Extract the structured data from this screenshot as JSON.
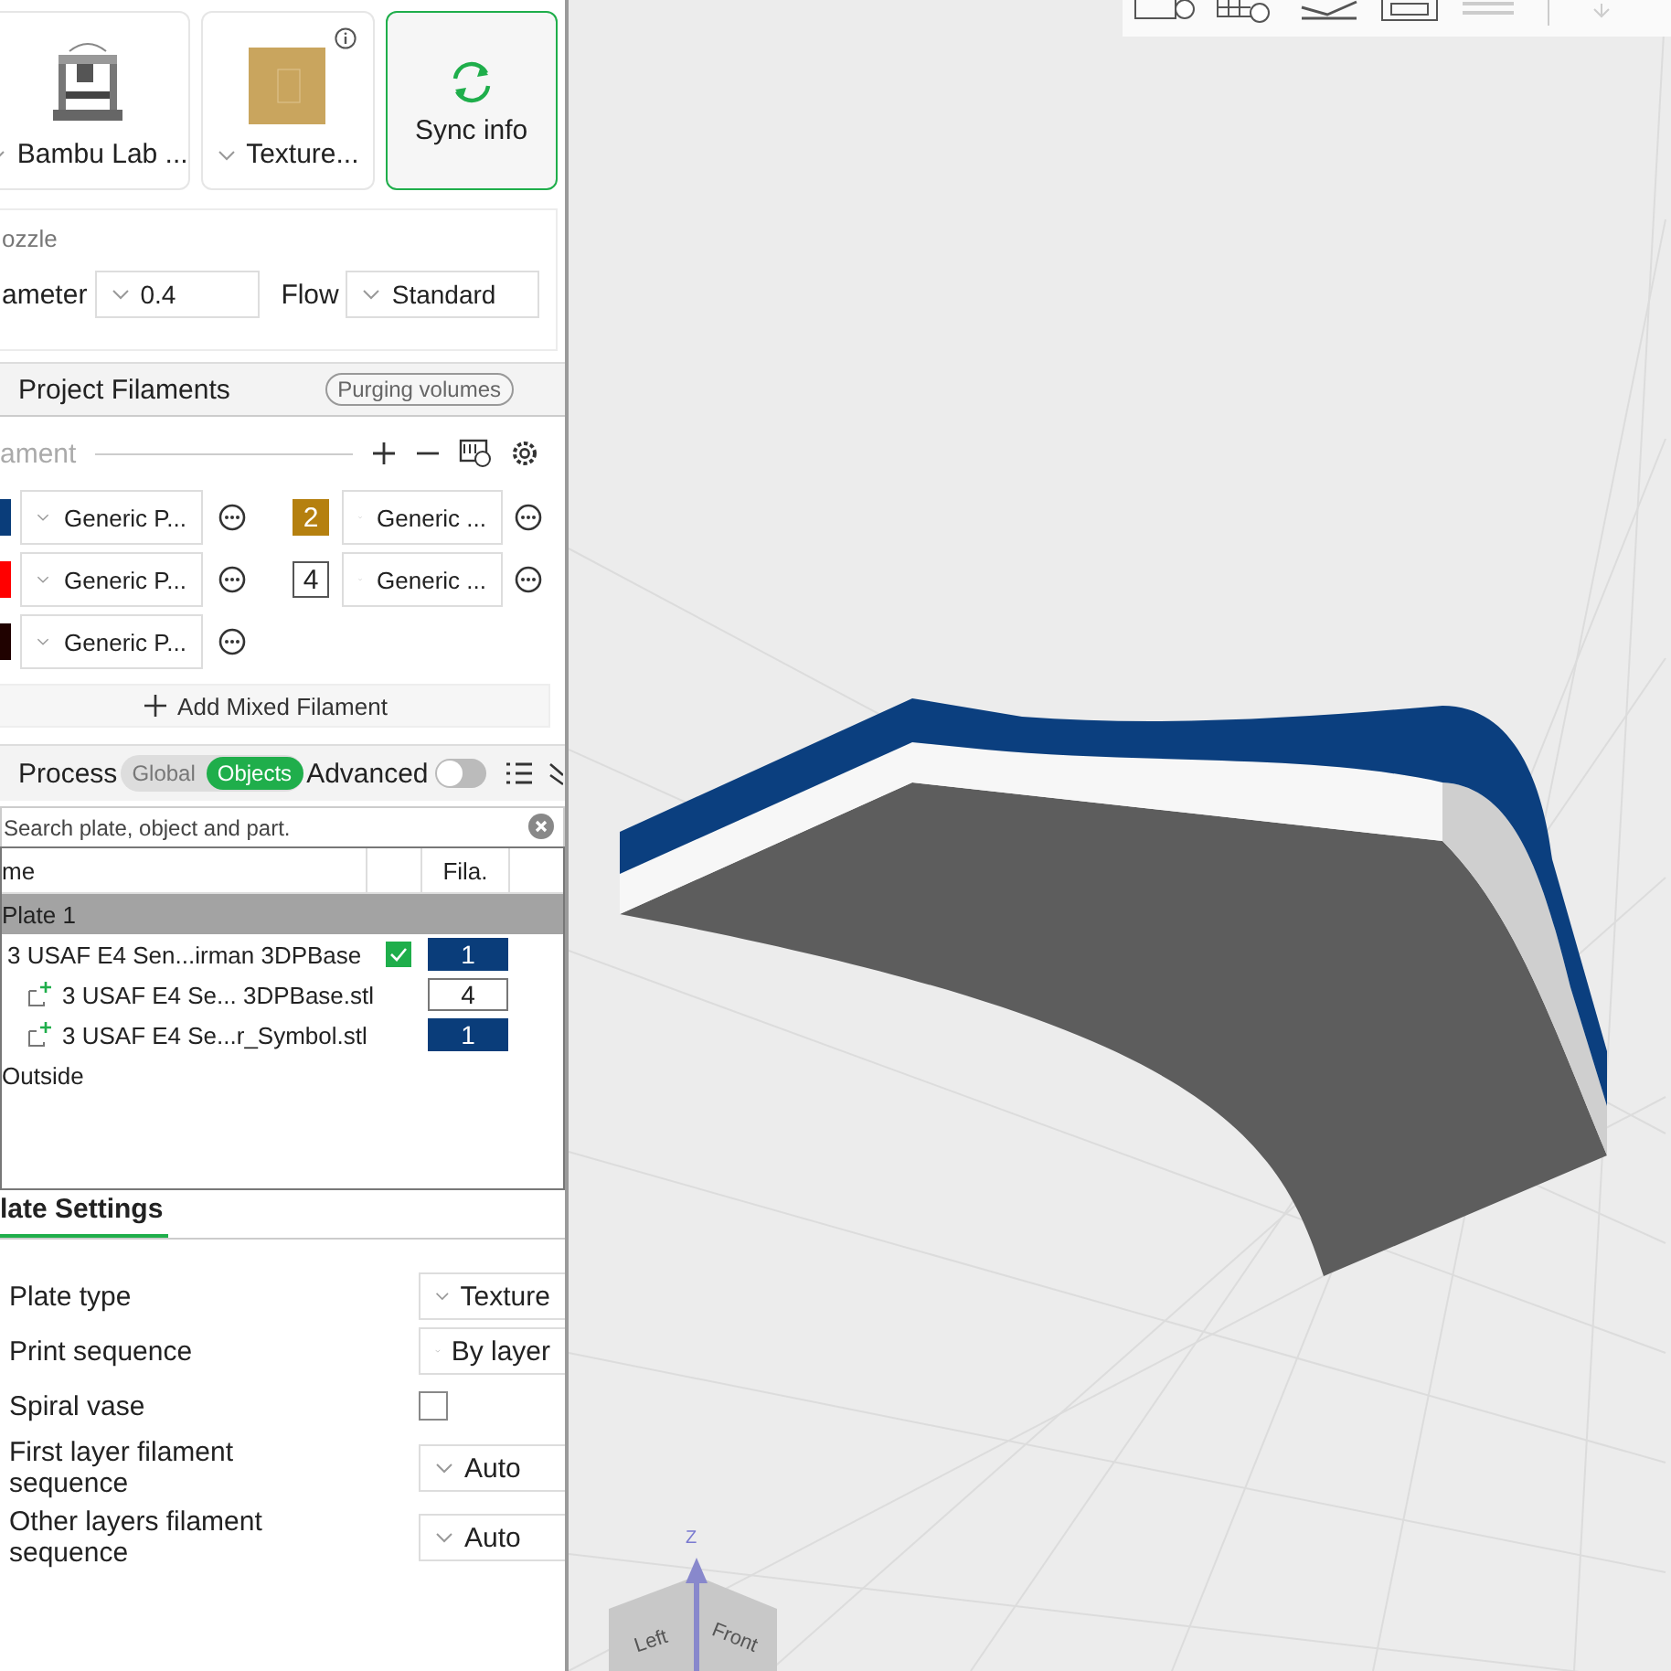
{
  "printer_cards": [
    {
      "kind": "printer",
      "label": "Bambu Lab ..."
    },
    {
      "kind": "plate",
      "label": "Texture..."
    },
    {
      "kind": "sync",
      "label": "Sync info"
    }
  ],
  "nozzle": {
    "title": "ozzle",
    "diameter_label": "ameter",
    "diameter": "0.4",
    "flow_label": "Flow",
    "flow": "Standard"
  },
  "filaments_header": {
    "title": "Project Filaments",
    "button": "Purging volumes"
  },
  "filament_toolbar": {
    "label": "ament"
  },
  "filaments": [
    {
      "color": "#0a3d7a",
      "name": "Generic P..."
    },
    {
      "color": "#b5800f",
      "number": "2",
      "name": "Generic ..."
    },
    {
      "color": "#ff0000",
      "name": "Generic P..."
    },
    {
      "color": "#ffffff",
      "number": "4",
      "name": "Generic ..."
    },
    {
      "color": "#200200",
      "name": "Generic P..."
    }
  ],
  "add_mixed": "Add Mixed Filament",
  "process": {
    "title": "Process",
    "modes": [
      {
        "label": "Global",
        "selected": false
      },
      {
        "label": "Objects",
        "selected": true
      }
    ],
    "advanced": {
      "label": "Advanced",
      "on": false
    }
  },
  "search": {
    "placeholder": "Search plate, object and part."
  },
  "object_table": {
    "columns": [
      "me",
      "Fila."
    ],
    "rows": [
      {
        "kind": "plate",
        "name": "Plate 1",
        "selected": true,
        "children": [
          {
            "kind": "object",
            "name": "3 USAF E4 Sen...irman 3DPBase",
            "selected": false,
            "checked": true,
            "filament": "1",
            "color": "#0a3d7a",
            "children": [
              {
                "kind": "part",
                "name": "3 USAF E4 Se... 3DPBase.stl",
                "selected": false,
                "filament": "4",
                "color": "#ffffff"
              },
              {
                "kind": "part",
                "name": "3 USAF E4 Se...r_Symbol.stl",
                "selected": false,
                "filament": "1",
                "color": "#0a3d7a"
              }
            ]
          }
        ]
      },
      {
        "kind": "plate",
        "name": "Outside",
        "selected": false
      }
    ]
  },
  "plate_settings": {
    "tab": "late Settings",
    "rows": [
      {
        "kind": "dropdown",
        "label": "Plate type",
        "value": "Texture"
      },
      {
        "kind": "dropdown",
        "label": "Print sequence",
        "value": "By layer"
      },
      {
        "kind": "checkbox",
        "label": "Spiral vase",
        "checked": false
      },
      {
        "kind": "dropdown",
        "label": "First layer filament sequence",
        "value": "Auto"
      },
      {
        "kind": "dropdown",
        "label": "Other layers filament sequence",
        "value": "Auto"
      }
    ]
  },
  "viewcube": {
    "axis": "Z",
    "faces": [
      "Left",
      "Front"
    ]
  }
}
